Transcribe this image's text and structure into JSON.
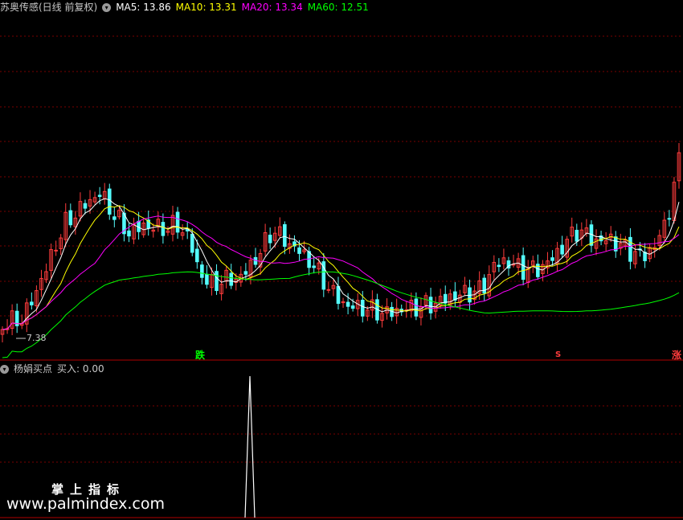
{
  "top_header": {
    "title": "苏奥传感(日线 前复权)",
    "ma5": "MA5: 13.86",
    "ma10": "MA10: 13.31",
    "ma20": "MA20: 13.34",
    "ma60": "MA60: 12.51"
  },
  "bottom_header": {
    "indicator": "杨娟买点",
    "value": "买入: 0.00"
  },
  "low_label": "7.38",
  "signals": {
    "down": "跌",
    "s": "S",
    "up": "涨"
  },
  "watermark": {
    "title": "掌上指标",
    "url": "www.palmindex.com"
  },
  "colors": {
    "up": "#ff3c3c",
    "down": "#54fcfc",
    "ma5": "#ffffff",
    "ma10": "#ffff00",
    "ma20": "#ff00ff",
    "ma60": "#00ff00",
    "grid": "#7a0000"
  },
  "chart_data": {
    "type": "candlestick",
    "ma_lines": [
      "MA5",
      "MA10",
      "MA20",
      "MA60"
    ],
    "indicator_spike": 1
  }
}
